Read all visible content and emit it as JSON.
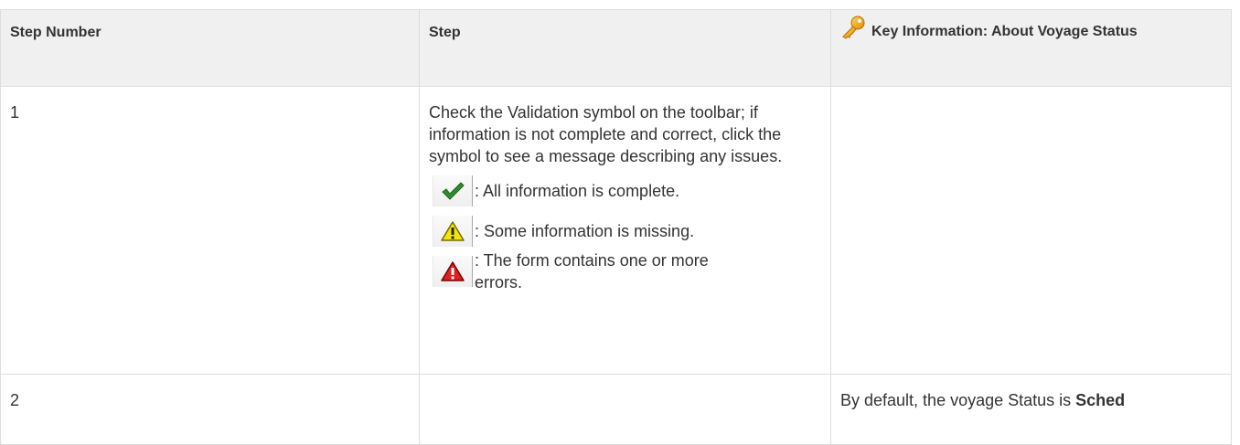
{
  "table": {
    "headers": {
      "step_number": "Step Number",
      "step": "Step",
      "key_info": "Key Information: About Voyage Status"
    },
    "rows": [
      {
        "number": "1",
        "step_text": "Check the Validation symbol on the toolbar; if information is not complete and correct, click the symbol to see a message describing any issues.",
        "legend": [
          {
            "icon": "checkmark-icon",
            "text": ": All information is complete."
          },
          {
            "icon": "warning-icon",
            "text": ": Some information is missing."
          },
          {
            "icon": "error-icon",
            "text": ": The form contains one or more errors."
          }
        ],
        "key_info": ""
      },
      {
        "number": "2",
        "step_text": "",
        "key_info_prefix": "By default, the voyage Status is ",
        "key_info_bold": "Sched"
      }
    ]
  },
  "colors": {
    "header_bg": "#f0f0f0",
    "border": "#dddddd",
    "key_header_text": "#2a4a8f",
    "check_green": "#2e8b2e",
    "warning_yellow": "#f2e600",
    "error_red": "#e02020"
  }
}
